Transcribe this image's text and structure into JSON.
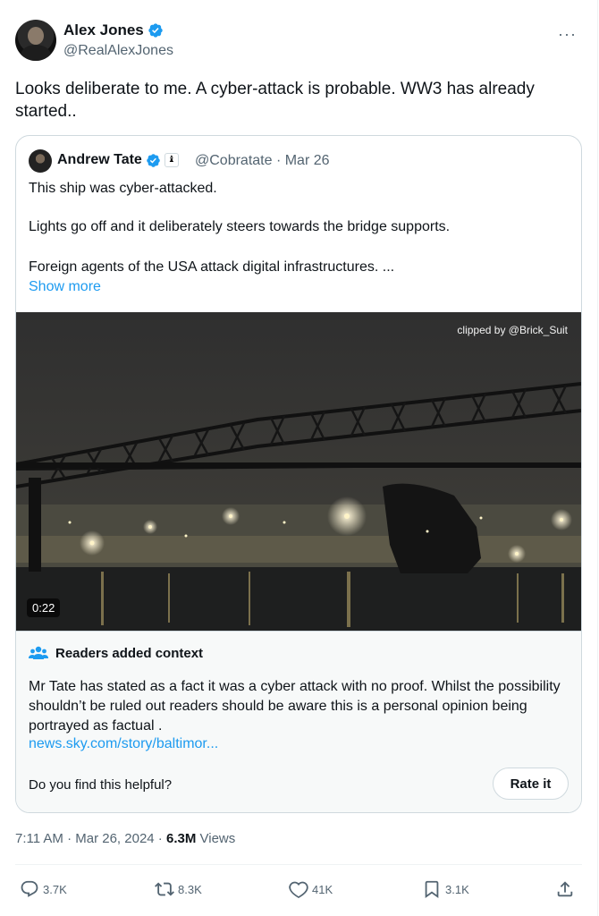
{
  "author": {
    "name": "Alex Jones",
    "handle": "@RealAlexJones",
    "more_label": "···"
  },
  "tweet": {
    "text": "Looks deliberate to me. A cyber-attack is probable. WW3 has already started.."
  },
  "quoted": {
    "name": "Andrew Tate",
    "badge": "♝",
    "meta": "@Cobratate · Mar 26",
    "paragraph_1": "This ship was cyber-attacked.",
    "paragraph_2": "Lights go off and it deliberately steers towards the bridge supports.",
    "paragraph_3": "Foreign agents of the USA attack digital infrastructures. ...",
    "show_more": "Show more",
    "video": {
      "credit": "clipped by @Brick_Suit",
      "duration": "0:22"
    }
  },
  "community_note": {
    "title": "Readers added context",
    "body": "Mr Tate has stated as a fact it was a cyber attack with no proof. Whilst the possibility shouldn’t be ruled out readers should be aware this is a personal opinion being portrayed as factual .",
    "link": "news.sky.com/story/baltimor...",
    "question": "Do you find this helpful?",
    "rate_label": "Rate it"
  },
  "timestamp": {
    "time_date": "7:11 AM · Mar 26, 2024 · ",
    "views_count": "6.3M",
    "views_label": " Views"
  },
  "actions": {
    "replies": "3.7K",
    "reposts": "8.3K",
    "likes": "41K",
    "bookmarks": "3.1K"
  },
  "colors": {
    "accent": "#1d9bf0",
    "text": "#0f1419",
    "secondary": "#536471",
    "border": "#cfd9de"
  }
}
